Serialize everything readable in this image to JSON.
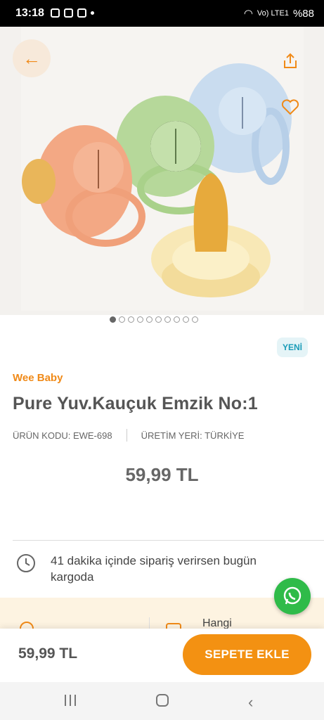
{
  "status_bar": {
    "time": "13:18",
    "battery": "%88",
    "network": "Vo) LTE1"
  },
  "product": {
    "badge": "YENİ",
    "brand": "Wee Baby",
    "title": "Pure Yuv.Kauçuk Emzik No:1",
    "code": "ÜRÜN KODU: EWE-698",
    "origin": "ÜRETİM YERİ: TÜRKİYE",
    "price": "59,99 TL"
  },
  "gallery": {
    "image_count": 10,
    "active_index": 0
  },
  "delivery": {
    "text": "41 dakika içinde sipariş verirsen bugün kargoda"
  },
  "info_strip": {
    "left_text": "...",
    "right_text": "Hangi"
  },
  "bottom_bar": {
    "price": "59,99 TL",
    "cart_label": "SEPETE EKLE"
  },
  "colors": {
    "accent": "#f39112",
    "brand": "#f08a18",
    "whatsapp": "#2fbb49",
    "badge_bg": "#e5f4f7"
  }
}
